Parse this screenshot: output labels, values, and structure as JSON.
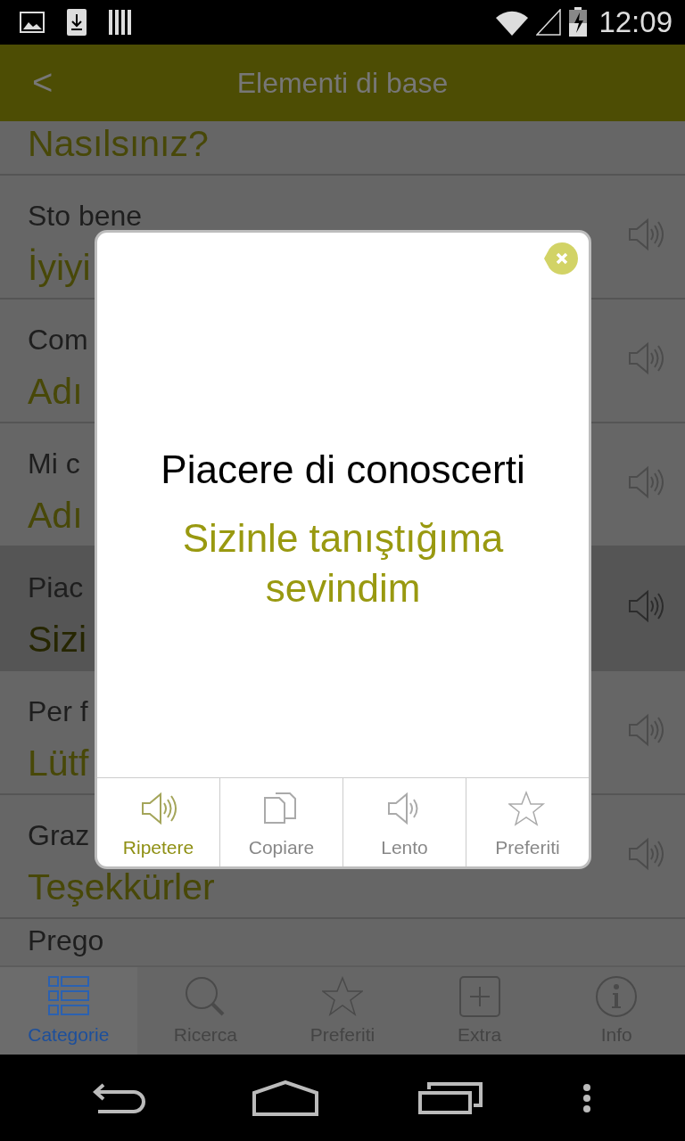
{
  "status_bar": {
    "time": "12:09"
  },
  "app_bar": {
    "back": "<",
    "title": "Elementi di base"
  },
  "phrases": [
    {
      "translation": "Nasılsınız?",
      "selected": false,
      "speaker": false
    },
    {
      "italian": "Sto bene",
      "translation": "İyiyi",
      "selected": false,
      "speaker": true
    },
    {
      "italian": "Com",
      "translation": "Adı",
      "selected": false,
      "speaker": true
    },
    {
      "italian": "Mi c",
      "translation": "Adı",
      "selected": false,
      "speaker": true
    },
    {
      "italian": "Piac",
      "translation": "Sizi",
      "selected": true,
      "speaker": true
    },
    {
      "italian": "Per f",
      "translation": "Lütf",
      "selected": false,
      "speaker": true
    },
    {
      "italian": "Graz",
      "translation": "Teşekkürler",
      "selected": false,
      "speaker": true
    },
    {
      "italian": "Prego",
      "selected": false,
      "speaker": false
    }
  ],
  "dialog": {
    "phrase": "Piacere di conoscerti",
    "translation": "Sizinle tanıştığıma sevindim",
    "actions": [
      {
        "label": "Ripetere",
        "kind": "speaker",
        "selected": true
      },
      {
        "label": "Copiare",
        "kind": "copy",
        "selected": false
      },
      {
        "label": "Lento",
        "kind": "slow",
        "selected": false
      },
      {
        "label": "Preferiti",
        "kind": "star",
        "selected": false
      }
    ]
  },
  "tabs": [
    {
      "label": "Categorie",
      "kind": "categories",
      "selected": true
    },
    {
      "label": "Ricerca",
      "kind": "search",
      "selected": false
    },
    {
      "label": "Preferiti",
      "kind": "star",
      "selected": false
    },
    {
      "label": "Extra",
      "kind": "plus",
      "selected": false
    },
    {
      "label": "Info",
      "kind": "info",
      "selected": false
    }
  ]
}
